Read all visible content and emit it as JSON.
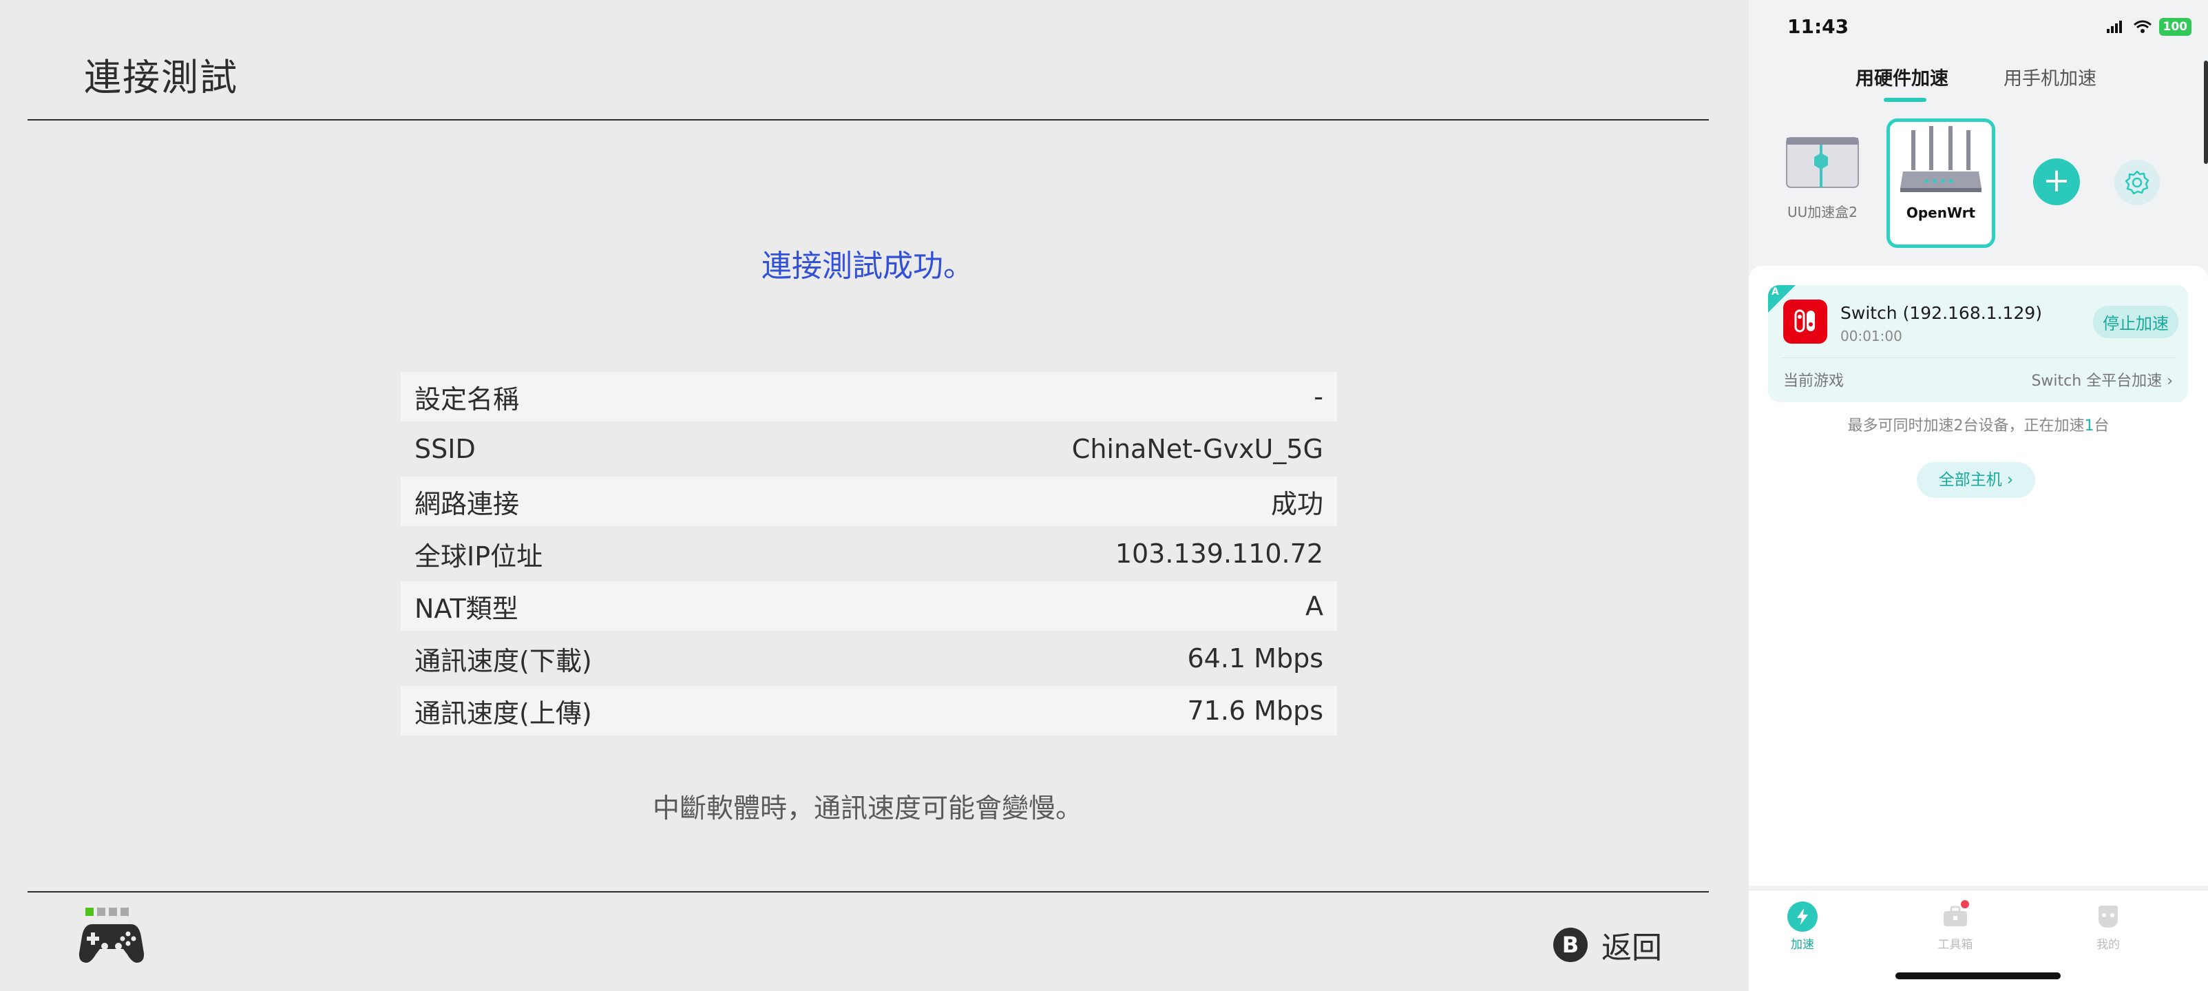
{
  "switch": {
    "title": "連接測試",
    "success": "連接測試成功。",
    "rows": [
      {
        "label": "設定名稱",
        "value": "-"
      },
      {
        "label": "SSID",
        "value": "ChinaNet-GvxU_5G"
      },
      {
        "label": "網路連接",
        "value": "成功"
      },
      {
        "label": "全球IP位址",
        "value": "103.139.110.72"
      },
      {
        "label": "NAT類型",
        "value": "A"
      },
      {
        "label": "通訊速度(下載)",
        "value": "64.1 Mbps"
      },
      {
        "label": "通訊速度(上傳)",
        "value": "71.6 Mbps"
      }
    ],
    "note": "中斷軟體時，通訊速度可能會變慢。",
    "back_button_key": "B",
    "back_label": "返回"
  },
  "phone": {
    "time": "11:43",
    "battery": "100",
    "tabs": [
      "用硬件加速",
      "用手机加速"
    ],
    "devices": [
      {
        "label": "UU加速盒2"
      },
      {
        "label": "OpenWrt"
      }
    ],
    "card": {
      "flag": "A",
      "device_name": "Switch (192.168.1.129)",
      "elapsed": "00:01:00",
      "stop_label": "停止加速",
      "current_game_label": "当前游戏",
      "current_game_value": "Switch 全平台加速"
    },
    "limit_prefix": "最多可同时加速2台设备，正在加速",
    "limit_count": "1",
    "limit_suffix": "台",
    "all_hosts_label": "全部主机",
    "nav": [
      {
        "label": "加速"
      },
      {
        "label": "工具箱"
      },
      {
        "label": "我的"
      }
    ],
    "colors": {
      "accent": "#2bc9bb",
      "switch_red": "#e60012",
      "success_blue": "#3251d6"
    }
  }
}
